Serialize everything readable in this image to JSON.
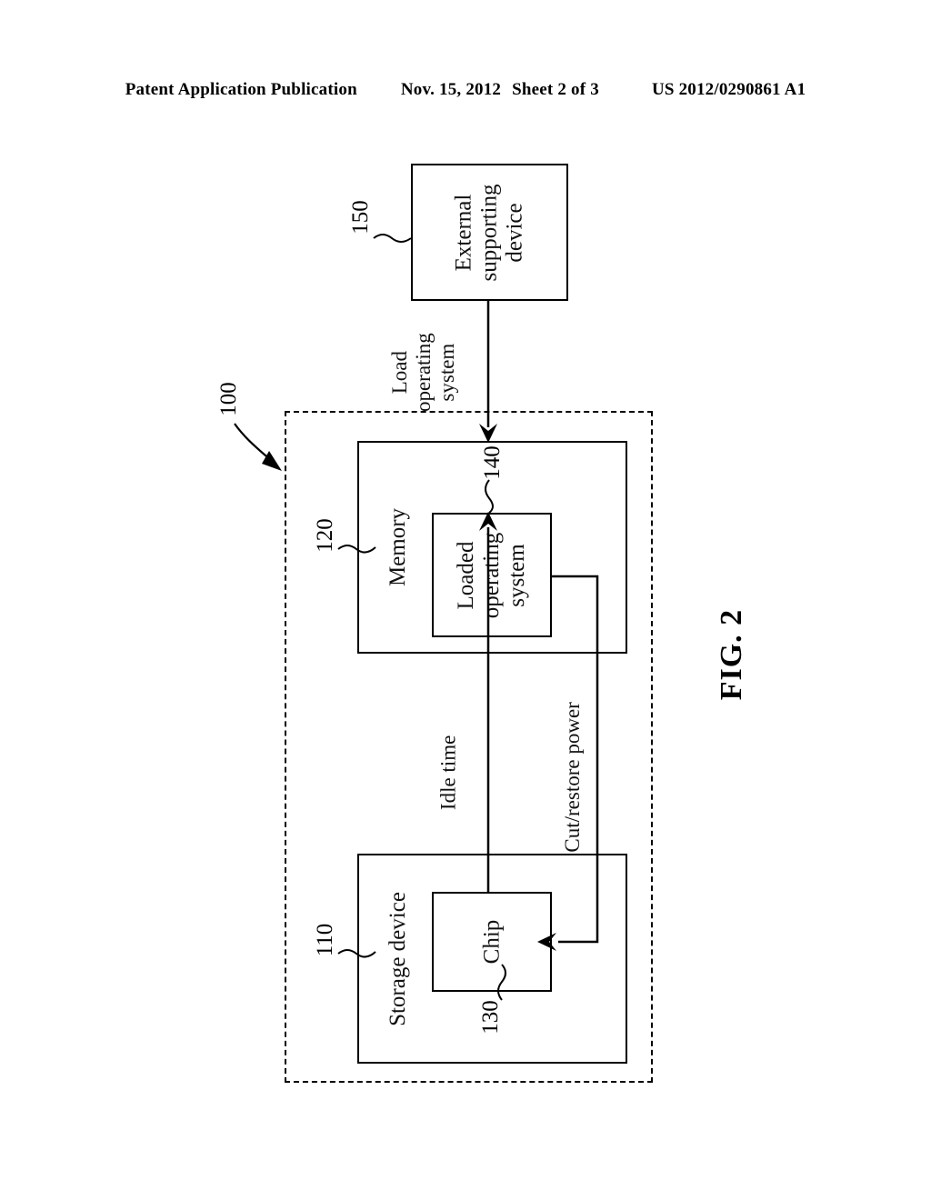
{
  "header": {
    "publication": "Patent Application Publication",
    "date": "Nov. 15, 2012",
    "sheet": "Sheet 2 of 3",
    "patent_number": "US 2012/0290861 A1"
  },
  "figure": {
    "caption": "FIG. 2",
    "system_ref": "100",
    "blocks": {
      "external_supporting_device": {
        "label": "External\nsupporting\ndevice",
        "line1": "External",
        "line2": "supporting",
        "line3": "device",
        "ref": "150"
      },
      "memory": {
        "label": "Memory",
        "ref": "120"
      },
      "loaded_operating_system": {
        "line1": "Loaded",
        "line2": "operating",
        "line3": "system",
        "ref": "140"
      },
      "storage_device": {
        "label": "Storage device",
        "ref": "110"
      },
      "chip": {
        "label": "Chip",
        "ref": "130"
      }
    },
    "connectors": {
      "load_os": {
        "line1": "Load",
        "line2": "operating",
        "line3": "system"
      },
      "idle_time": {
        "label": "Idle time"
      },
      "cut_restore_power": {
        "label": "Cut/restore power"
      }
    }
  }
}
